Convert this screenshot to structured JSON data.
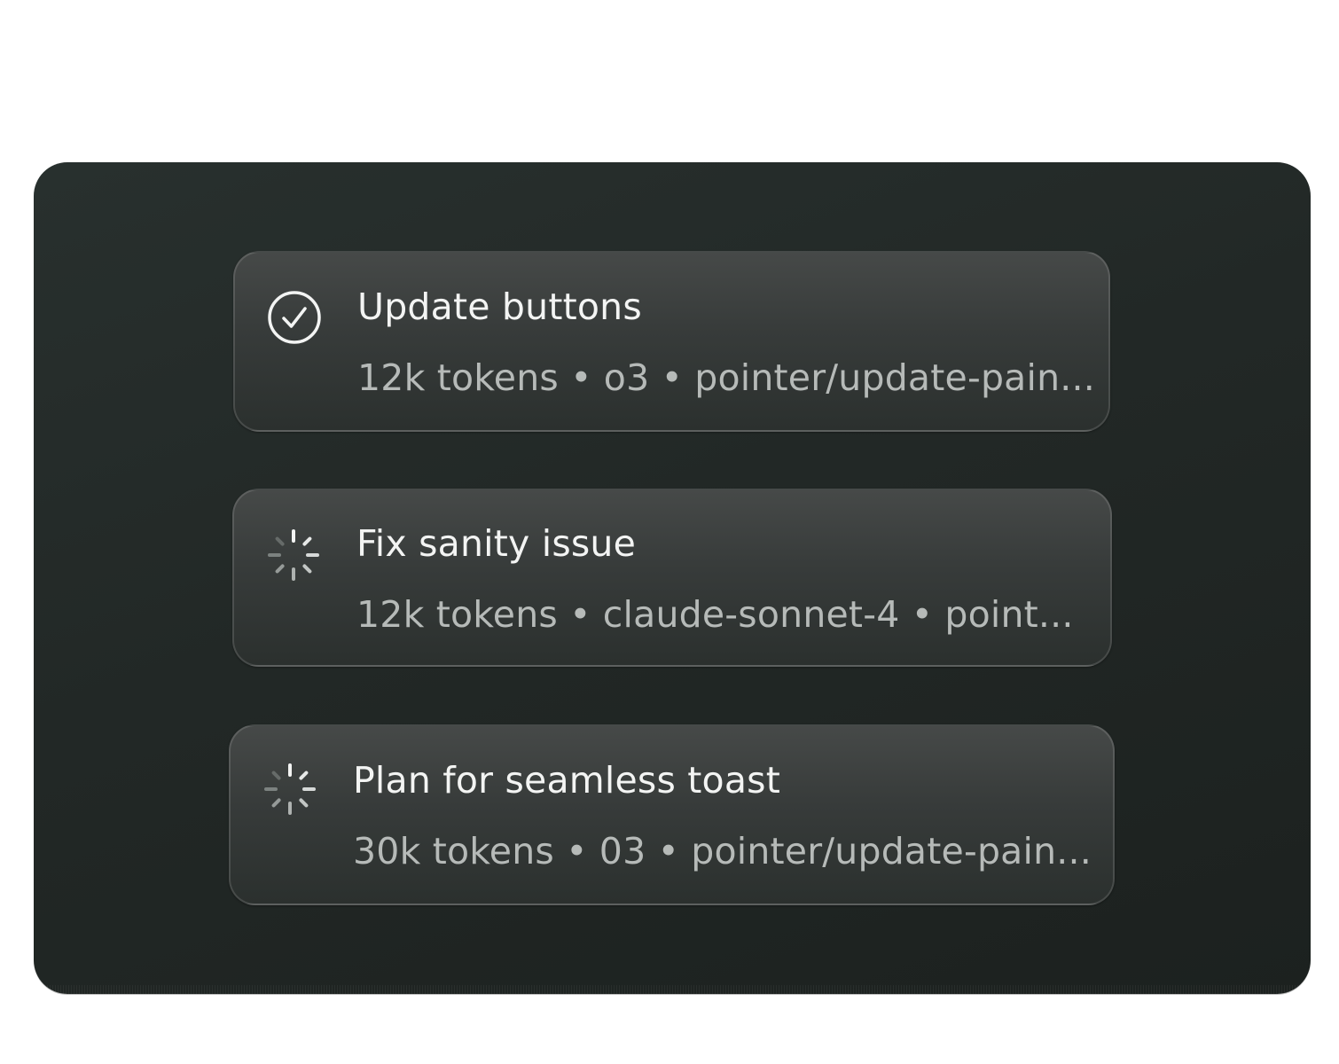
{
  "tasks": [
    {
      "status_icon": "check-circle-icon",
      "title": "Update buttons",
      "meta": "12k tokens • o3 • pointer/update-pain..."
    },
    {
      "status_icon": "spinner-icon",
      "title": "Fix sanity issue",
      "meta": "12k tokens • claude-sonnet-4 • point..."
    },
    {
      "status_icon": "spinner-icon",
      "title": "Plan for seamless toast",
      "meta": "30k tokens • 03 • pointer/update-pain..."
    }
  ],
  "colors": {
    "panel_bg": "#232927",
    "card_bg": "#3c403f",
    "title_text": "#f3f4f3",
    "meta_text": "#b6bab8"
  }
}
